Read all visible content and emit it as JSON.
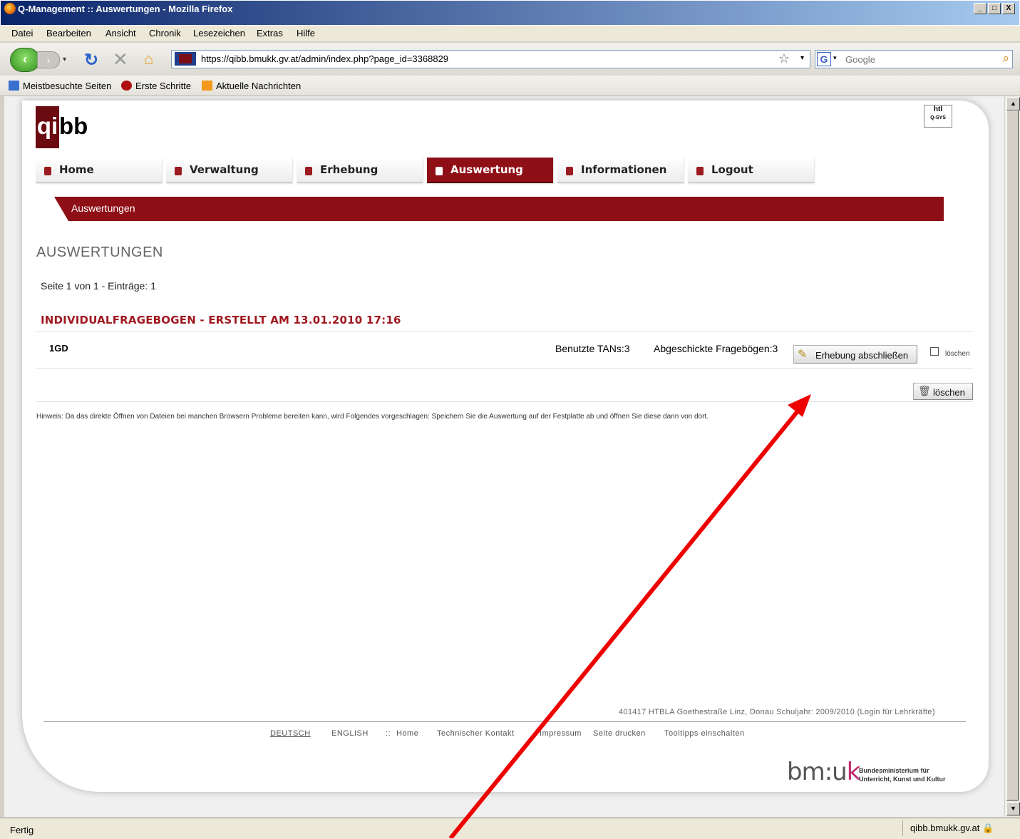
{
  "window": {
    "title": "Q-Management :: Auswertungen - Mozilla Firefox",
    "buttons": [
      "_",
      "□",
      "X"
    ]
  },
  "menu": [
    "Datei",
    "Bearbeiten",
    "Ansicht",
    "Chronik",
    "Lesezeichen",
    "Extras",
    "Hilfe"
  ],
  "toolbar": {
    "url": "https://qibb.bmukk.gv.at/admin/index.php?page_id=3368829",
    "search_placeholder": "Google"
  },
  "bookmarks": [
    "Meistbesuchte Seiten",
    "Erste Schritte",
    "Aktuelle Nachrichten"
  ],
  "logo": {
    "part1": "qi",
    "part2": "bb"
  },
  "badge": {
    "line1": "htl",
    "line2": "Q-SYS"
  },
  "tabs": [
    "Home",
    "Verwaltung",
    "Erhebung",
    "Auswertung",
    "Informationen",
    "Logout"
  ],
  "active_tab": "Auswertung",
  "breadcrumb": "Auswertungen",
  "heading": "AUSWERTUNGEN",
  "pagination": "Seite 1 von 1 - Einträge: 1",
  "section": {
    "title": "INDIVIDUALFRAGEBOGEN - ERSTELLT AM 13.01.2010 17:16",
    "row": {
      "name": "1GD",
      "tans": "Benutzte TANs:3",
      "sent": "Abgeschickte Fragebögen:3",
      "close_button": "Erhebung abschließen",
      "checkbox_label": "löschen"
    }
  },
  "delete_button": "löschen",
  "hint": "Hinweis: Da das direkte Öffnen von Dateien bei manchen Browsern Probleme bereiten kann, wird Folgendes vorgeschlagen: Speichern Sie die Auswertung auf der Festplatte ab und öffnen Sie diese dann von dort.",
  "footer": {
    "school_info": "401417 HTBLA Goethestraße Linz, Donau Schuljahr: 2009/2010 (Login für Lehrkräfte)",
    "links": [
      "DEUTSCH",
      "ENGLISH",
      "::",
      "Home",
      "Technischer Kontakt",
      "Impressum",
      "Seite drucken",
      "Tooltipps einschalten"
    ],
    "logo_text": "bm:u",
    "logo_k": "k",
    "logo_sub1": "Bundesministerium für",
    "logo_sub2": "Unterricht, Kunst und Kultur"
  },
  "status": {
    "left": "Fertig",
    "host": "qibb.bmukk.gv.at"
  },
  "colors": {
    "brand": "#8f0f16",
    "heading_red": "#a01820",
    "arrow": "#ee0000"
  }
}
